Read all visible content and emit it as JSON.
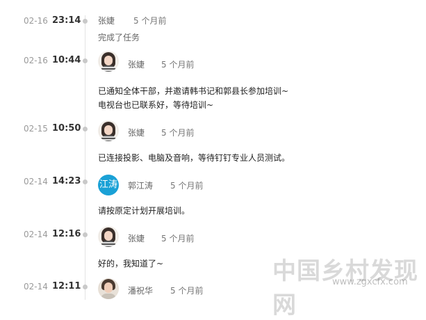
{
  "entries": [
    {
      "date": "02-16",
      "time": "23:14",
      "author": "张婕",
      "ago": "5 个月前",
      "content": [
        "完成了任务"
      ]
    },
    {
      "date": "02-16",
      "time": "10:44",
      "author": "张婕",
      "ago": "5 个月前",
      "content": [
        "已通知全体干部，并邀请韩书记和郭县长参加培训~",
        "电视台也已联系好，等待培训~"
      ]
    },
    {
      "date": "02-15",
      "time": "10:50",
      "author": "张婕",
      "ago": "5 个月前",
      "content": [
        "已连接投影、电脑及音响，等待钉钉专业人员测试。"
      ]
    },
    {
      "date": "02-14",
      "time": "14:23",
      "author": "郭江涛",
      "avatar_text": "江涛",
      "ago": "5 个月前",
      "content": [
        "请按原定计划开展培训。"
      ]
    },
    {
      "date": "02-14",
      "time": "12:16",
      "author": "张婕",
      "ago": "5 个月前",
      "content": [
        "好的，我知道了~"
      ]
    },
    {
      "date": "02-14",
      "time": "12:11",
      "author": "潘祝华",
      "ago": "5 个月前",
      "content": []
    }
  ],
  "watermark": {
    "text": "中国乡村发现网",
    "url": "www.zgxcfx.com"
  },
  "colors": {
    "avatar_text_bg": "#1aa1d6",
    "timeline": "#e3e3e3",
    "dot": "#c9c9c9"
  }
}
